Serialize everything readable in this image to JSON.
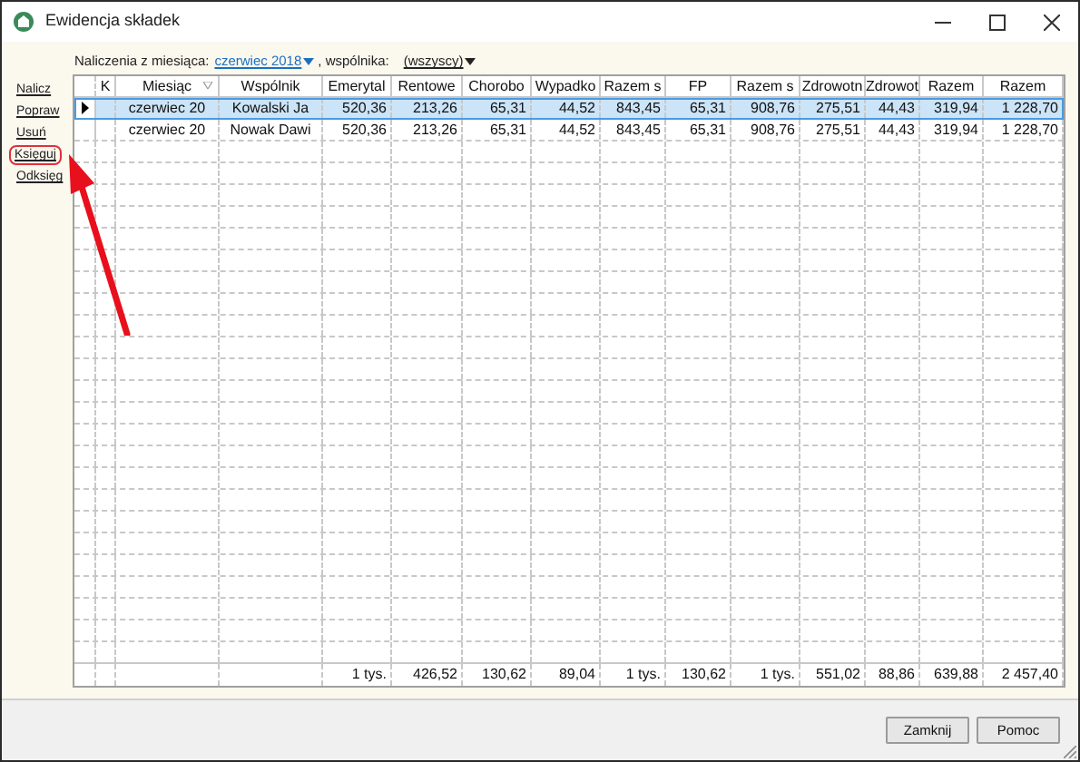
{
  "window": {
    "title": "Ewidencja składek"
  },
  "filter": {
    "month_label": "Naliczenia z miesiąca:",
    "month_value": "czerwiec 2018",
    "partner_label": ", wspólnika:",
    "partner_value": "(wszyscy)"
  },
  "sidebar": {
    "items": [
      {
        "label": "Nalicz",
        "highlighted": false
      },
      {
        "label": "Popraw",
        "highlighted": false
      },
      {
        "label": "Usuń",
        "highlighted": false
      },
      {
        "label": "Księguj",
        "highlighted": true
      },
      {
        "label": "Odksięg",
        "highlighted": false
      }
    ]
  },
  "table": {
    "columns": [
      "K",
      "Miesiąc",
      "Wspólnik",
      "Emerytal",
      "Rentowe",
      "Chorobo",
      "Wypadko",
      "Razem s",
      "FP",
      "Razem s",
      "Zdrowotn",
      "Zdrowot",
      "Razem",
      "Razem"
    ],
    "rows": [
      {
        "selected": true,
        "cells": [
          "",
          "czerwiec 20",
          "Kowalski Ja",
          "520,36",
          "213,26",
          "65,31",
          "44,52",
          "843,45",
          "65,31",
          "908,76",
          "275,51",
          "44,43",
          "319,94",
          "1 228,70"
        ]
      },
      {
        "selected": false,
        "cells": [
          "",
          "czerwiec 20",
          "Nowak Dawi",
          "520,36",
          "213,26",
          "65,31",
          "44,52",
          "843,45",
          "65,31",
          "908,76",
          "275,51",
          "44,43",
          "319,94",
          "1 228,70"
        ]
      }
    ],
    "totals": [
      "1 tys.",
      "426,52",
      "130,62",
      "89,04",
      "1 tys.",
      "130,62",
      "1 tys.",
      "551,02",
      "88,86",
      "639,88",
      "2 457,40"
    ]
  },
  "buttons": [
    {
      "label": "Zamknij"
    },
    {
      "label": "Pomoc"
    }
  ]
}
